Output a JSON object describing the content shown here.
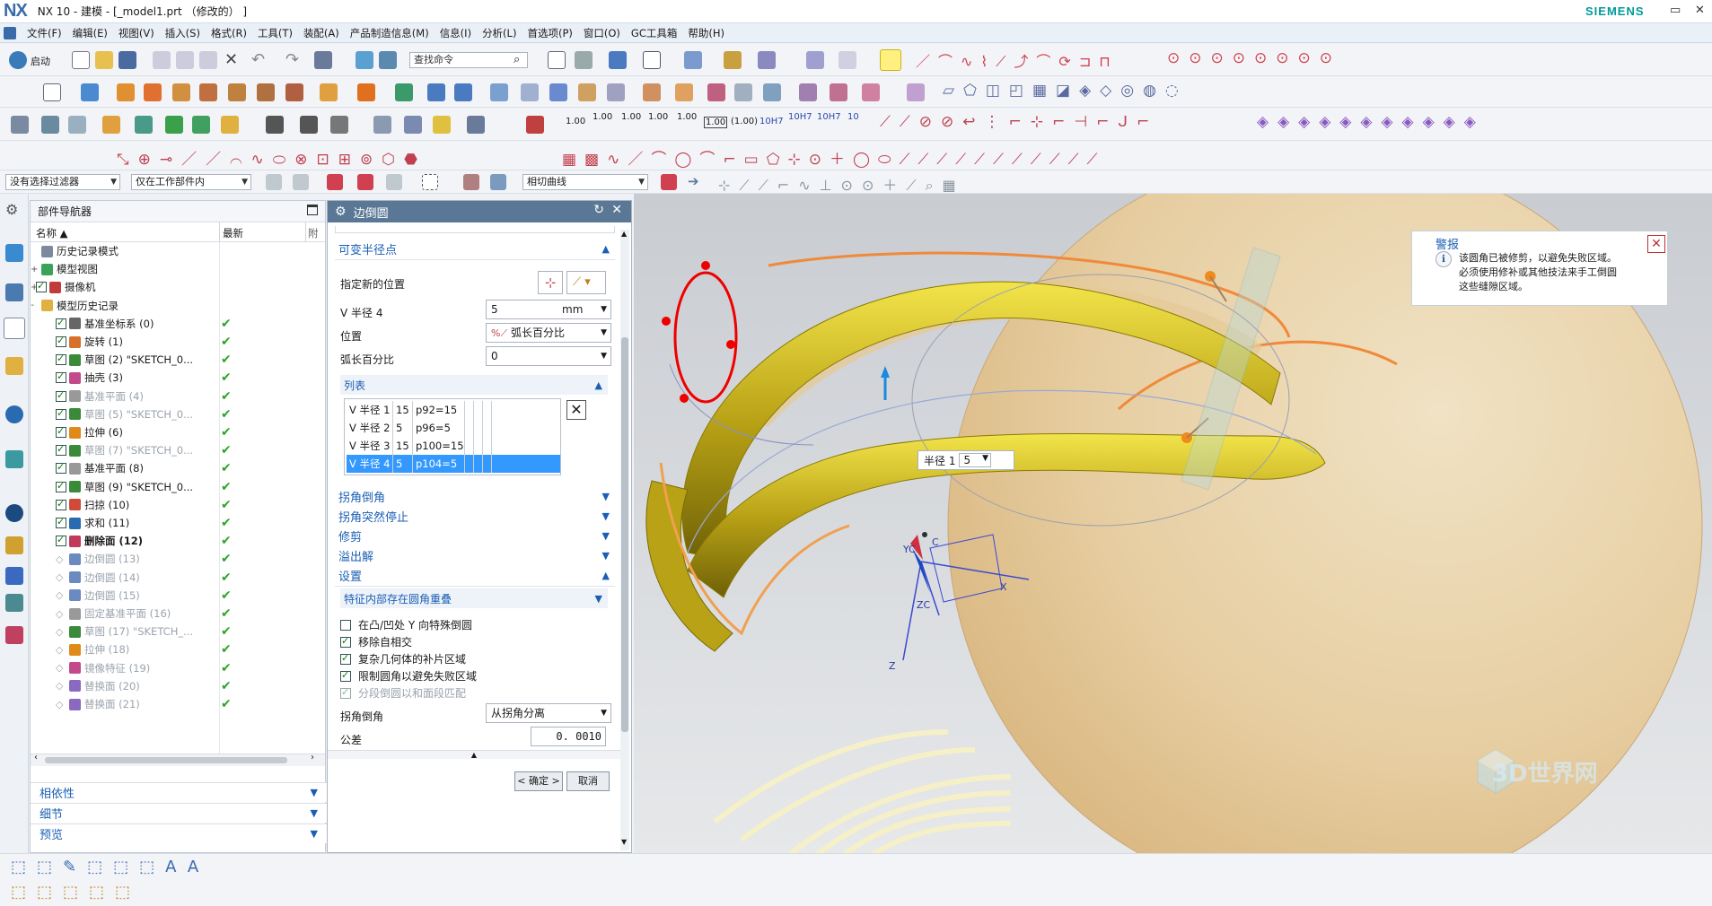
{
  "title": {
    "app_logo": "NX",
    "text": "NX 10 - 建模 - [_model1.prt （修改的） ]",
    "brand": "SIEMENS"
  },
  "menu": [
    "文件(F)",
    "编辑(E)",
    "视图(V)",
    "插入(S)",
    "格式(R)",
    "工具(T)",
    "装配(A)",
    "产品制造信息(M)",
    "信息(I)",
    "分析(L)",
    "首选项(P)",
    "窗口(O)",
    "GC工具箱",
    "帮助(H)"
  ],
  "toolbar": {
    "start_label": "启动",
    "command_search_placeholder": "查找命令",
    "selection_filter": "没有选择过滤器",
    "scope": "仅在工作部件内",
    "curve_rule": "相切曲线",
    "tolerance_labels": [
      "1.00",
      "1.00",
      "1.00",
      "1.00",
      "1.00",
      "1.00",
      "(1.00)",
      "10H7",
      "10H7",
      "10H7",
      "10"
    ]
  },
  "navigator": {
    "title": "部件导航器",
    "col_name": "名称",
    "col_latest": "最新",
    "col_extra": "附",
    "tree": [
      {
        "label": "历史记录模式",
        "indent": 1,
        "checked": null,
        "latest": false,
        "dim": false,
        "bold": false,
        "icon": "history-mode-icon",
        "color": "#7b8a9c"
      },
      {
        "label": "模型视图",
        "indent": 1,
        "checked": null,
        "latest": false,
        "dim": false,
        "bold": false,
        "icon": "model-views-icon",
        "color": "#3aa357",
        "expander": "+"
      },
      {
        "label": "摄像机",
        "indent": 1,
        "checked": true,
        "latest": false,
        "dim": false,
        "bold": false,
        "icon": "camera-icon",
        "color": "#c23b3b",
        "expander": "+"
      },
      {
        "label": "模型历史记录",
        "indent": 1,
        "checked": null,
        "latest": false,
        "dim": false,
        "bold": false,
        "icon": "model-history-icon",
        "color": "#e0b040",
        "expander": "-"
      },
      {
        "label": "基准坐标系 (0)",
        "indent": 2,
        "checked": true,
        "latest": true,
        "dim": false,
        "bold": false,
        "icon": "datum-csys-icon",
        "color": "#666"
      },
      {
        "label": "旋转 (1)",
        "indent": 2,
        "checked": true,
        "latest": true,
        "dim": false,
        "bold": false,
        "icon": "revolve-icon",
        "color": "#d6702a"
      },
      {
        "label": "草图 (2) \"SKETCH_0...",
        "indent": 2,
        "checked": true,
        "latest": true,
        "dim": false,
        "bold": false,
        "icon": "sketch-icon",
        "color": "#3a8a3a"
      },
      {
        "label": "抽壳 (3)",
        "indent": 2,
        "checked": true,
        "latest": true,
        "dim": false,
        "bold": false,
        "icon": "shell-icon",
        "color": "#c24a8a"
      },
      {
        "label": "基准平面 (4)",
        "indent": 2,
        "checked": true,
        "latest": true,
        "dim": true,
        "bold": false,
        "icon": "datum-plane-icon",
        "color": "#999"
      },
      {
        "label": "草图 (5) \"SKETCH_0...",
        "indent": 2,
        "checked": true,
        "latest": true,
        "dim": true,
        "bold": false,
        "icon": "sketch-icon",
        "color": "#3a8a3a"
      },
      {
        "label": "拉伸 (6)",
        "indent": 2,
        "checked": true,
        "latest": true,
        "dim": false,
        "bold": false,
        "icon": "extrude-icon",
        "color": "#e08a1a"
      },
      {
        "label": "草图 (7) \"SKETCH_0...",
        "indent": 2,
        "checked": true,
        "latest": true,
        "dim": true,
        "bold": false,
        "icon": "sketch-icon",
        "color": "#3a8a3a"
      },
      {
        "label": "基准平面 (8)",
        "indent": 2,
        "checked": true,
        "latest": true,
        "dim": false,
        "bold": false,
        "icon": "datum-plane-icon",
        "color": "#999"
      },
      {
        "label": "草图 (9) \"SKETCH_0...",
        "indent": 2,
        "checked": true,
        "latest": true,
        "dim": false,
        "bold": false,
        "icon": "sketch-icon",
        "color": "#3a8a3a"
      },
      {
        "label": "扫掠 (10)",
        "indent": 2,
        "checked": true,
        "latest": true,
        "dim": false,
        "bold": false,
        "icon": "sweep-icon",
        "color": "#d04a3a"
      },
      {
        "label": "求和 (11)",
        "indent": 2,
        "checked": true,
        "latest": true,
        "dim": false,
        "bold": false,
        "icon": "unite-icon",
        "color": "#2a6ab0"
      },
      {
        "label": "删除面 (12)",
        "indent": 2,
        "checked": true,
        "latest": true,
        "dim": false,
        "bold": true,
        "icon": "delete-face-icon",
        "color": "#c03a5a"
      },
      {
        "label": "边倒圆 (13)",
        "indent": 2,
        "checked": null,
        "latest": true,
        "dim": true,
        "bold": false,
        "icon": "edge-blend-icon",
        "color": "#6a8ac0"
      },
      {
        "label": "边倒圆 (14)",
        "indent": 2,
        "checked": null,
        "latest": true,
        "dim": true,
        "bold": false,
        "icon": "edge-blend-icon",
        "color": "#6a8ac0"
      },
      {
        "label": "边倒圆 (15)",
        "indent": 2,
        "checked": null,
        "latest": true,
        "dim": true,
        "bold": false,
        "icon": "edge-blend-icon",
        "color": "#6a8ac0"
      },
      {
        "label": "固定基准平面 (16)",
        "indent": 2,
        "checked": null,
        "latest": true,
        "dim": true,
        "bold": false,
        "icon": "fixed-datum-plane-icon",
        "color": "#999"
      },
      {
        "label": "草图 (17) \"SKETCH_...",
        "indent": 2,
        "checked": null,
        "latest": true,
        "dim": true,
        "bold": false,
        "icon": "sketch-icon",
        "color": "#3a8a3a"
      },
      {
        "label": "拉伸 (18)",
        "indent": 2,
        "checked": null,
        "latest": true,
        "dim": true,
        "bold": false,
        "icon": "extrude-icon",
        "color": "#e08a1a"
      },
      {
        "label": "镜像特征 (19)",
        "indent": 2,
        "checked": null,
        "latest": true,
        "dim": true,
        "bold": false,
        "icon": "mirror-feature-icon",
        "color": "#c24a8a"
      },
      {
        "label": "替换面 (20)",
        "indent": 2,
        "checked": null,
        "latest": true,
        "dim": true,
        "bold": false,
        "icon": "replace-face-icon",
        "color": "#8a6ac0"
      },
      {
        "label": "替换面 (21)",
        "indent": 2,
        "checked": null,
        "latest": true,
        "dim": true,
        "bold": false,
        "icon": "replace-face-icon",
        "color": "#8a6ac0"
      }
    ],
    "sections": [
      "相依性",
      "细节",
      "预览"
    ]
  },
  "dialog": {
    "title": "边倒圆",
    "variable_radius_group": "可变半径点",
    "specify_location_label": "指定新的位置",
    "v_radius_label": "V 半径 4",
    "v_radius_value": "5",
    "v_radius_unit": "mm",
    "position_label": "位置",
    "position_value": "弧长百分比",
    "arc_percent_label": "弧长百分比",
    "arc_percent_value": "0",
    "list_group": "列表",
    "list_rows": [
      {
        "name": "V 半径 1",
        "value": "15",
        "point": "p92=15"
      },
      {
        "name": "V 半径 2",
        "value": "5",
        "point": "p96=5"
      },
      {
        "name": "V 半径 3",
        "value": "15",
        "point": "p100=15"
      },
      {
        "name": "V 半径 4",
        "value": "5",
        "point": "p104=5"
      }
    ],
    "selected_row": 3,
    "collapsed_groups": [
      "拐角倒角",
      "拐角突然停止",
      "修剪",
      "溢出解"
    ],
    "settings_group": "设置",
    "settings_subgroup": "特征内部存在圆角重叠",
    "options": [
      {
        "label": "在凸/凹处 Y 向特殊倒圆",
        "checked": false,
        "disabled": false
      },
      {
        "label": "移除自相交",
        "checked": true,
        "disabled": false
      },
      {
        "label": "复杂几何体的补片区域",
        "checked": true,
        "disabled": false
      },
      {
        "label": "限制圆角以避免失败区域",
        "checked": true,
        "disabled": false
      },
      {
        "label": "分段倒圆以和面段匹配",
        "checked": true,
        "disabled": true
      }
    ],
    "corner_chamfer_label": "拐角倒角",
    "corner_chamfer_value": "从拐角分离",
    "tolerance_label": "公差",
    "tolerance_value": "0. 0010",
    "ok_label": "< 确定 >",
    "cancel_label": "取消"
  },
  "viewport": {
    "alert_title": "警报",
    "alert_text_lines": [
      "该圆角已被修剪，以避免失败区域。",
      "必须使用修补或其他技法来手工倒圆",
      "这些缝隙区域。"
    ],
    "radius_label": "半径 1",
    "radius_value": "5",
    "axis_x": "X",
    "axis_yc": "YC",
    "axis_zc": "ZC",
    "axis_z": "Z",
    "axis_c": "C",
    "watermark": "3D世界网"
  },
  "colors": {
    "dialog_header": "#5a7896",
    "accent_blue": "#1a5fb4",
    "selection": "#3399ff",
    "body_tan": "#e8c99a",
    "blend_yellow": "#c8b414",
    "edge_orange": "#f0a050",
    "siemens_teal": "#009999"
  }
}
